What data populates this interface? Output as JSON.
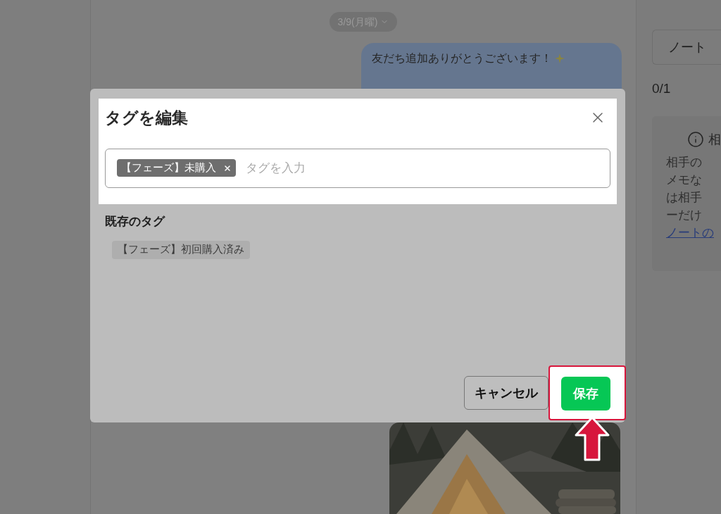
{
  "background": {
    "date_pill": "3/9(月曜)",
    "message": "友だち追加ありがとうございます！",
    "side_panel": {
      "tab": "ノート",
      "count": "0/1",
      "info_title": "相",
      "info_lines": [
        "相手の",
        "メモな",
        "は相手",
        "ーだけ"
      ],
      "link": "ノートの"
    }
  },
  "dialog": {
    "title": "タグを編集",
    "tag_input": {
      "tags": [
        {
          "label": "【フェーズ】未購入"
        }
      ],
      "placeholder": "タグを入力"
    },
    "existing_heading": "既存のタグ",
    "existing_tags": [
      {
        "label": "【フェーズ】初回購入済み"
      }
    ],
    "buttons": [
      {
        "label": "キャンセル",
        "kind": "secondary",
        "highlighted": false
      },
      {
        "label": "保存",
        "kind": "primary",
        "highlighted": true
      }
    ]
  }
}
